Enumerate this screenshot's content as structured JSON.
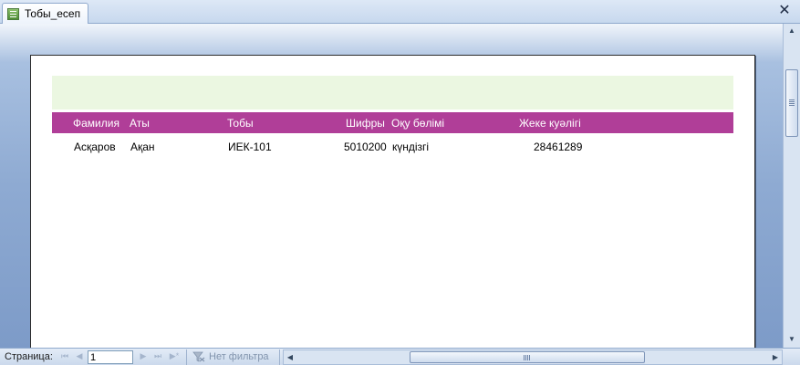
{
  "tab": {
    "title": "Тобы_есеп",
    "close_glyph": "✕"
  },
  "report": {
    "columns": [
      "Фамилия",
      "Аты",
      "Тобы",
      "Шифры",
      "Оқу бөлімі",
      "Жеке куәлігі"
    ],
    "rows": [
      [
        "Асқаров",
        "Ақан",
        "ИЕК-101",
        "5010200",
        "күндізгі",
        "28461289"
      ]
    ],
    "colors": {
      "header_band": "#b03e98",
      "report_header": "#ebf7e1"
    }
  },
  "statusbar": {
    "page_label": "Страница:",
    "page_value": "1",
    "nav": {
      "first": "⏮",
      "prev": "◀",
      "next": "▶",
      "last": "⏭",
      "new": "▶*"
    },
    "filter_label": "Нет фильтра"
  },
  "icons": {
    "scroll_up": "▲",
    "scroll_down": "▼",
    "scroll_left": "◀",
    "scroll_right": "▶"
  }
}
